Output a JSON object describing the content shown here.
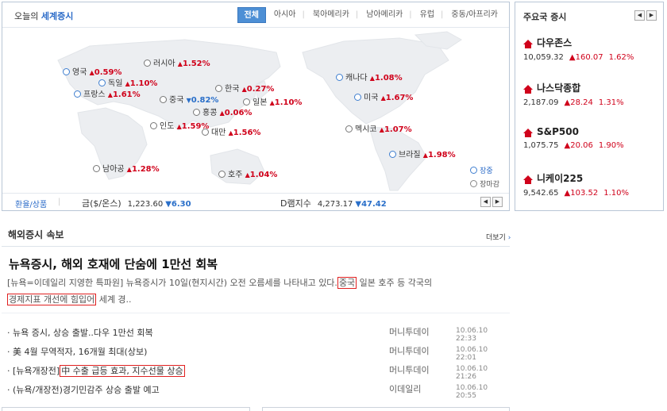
{
  "world": {
    "title_prefix": "오늘의 ",
    "title_main": "세계증시",
    "tabs": [
      "전체",
      "아시아",
      "북아메리카",
      "남아메리카",
      "유럽",
      "중동/아프리카"
    ],
    "markets": [
      {
        "name": "영국",
        "dir": "up",
        "value": "0.59%",
        "status": "day"
      },
      {
        "name": "독일",
        "dir": "up",
        "value": "1.10%",
        "status": "day"
      },
      {
        "name": "프랑스",
        "dir": "up",
        "value": "1.61%",
        "status": "day"
      },
      {
        "name": "러시아",
        "dir": "up",
        "value": "1.52%",
        "status": "closed"
      },
      {
        "name": "중국",
        "dir": "down",
        "value": "0.82%",
        "status": "closed"
      },
      {
        "name": "한국",
        "dir": "up",
        "value": "0.27%",
        "status": "closed"
      },
      {
        "name": "홍콩",
        "dir": "up",
        "value": "0.06%",
        "status": "closed"
      },
      {
        "name": "일본",
        "dir": "up",
        "value": "1.10%",
        "status": "closed"
      },
      {
        "name": "인도",
        "dir": "up",
        "value": "1.59%",
        "status": "closed"
      },
      {
        "name": "대만",
        "dir": "up",
        "value": "1.56%",
        "status": "closed"
      },
      {
        "name": "캐나다",
        "dir": "up",
        "value": "1.08%",
        "status": "day"
      },
      {
        "name": "미국",
        "dir": "up",
        "value": "1.67%",
        "status": "day"
      },
      {
        "name": "멕시코",
        "dir": "up",
        "value": "1.07%",
        "status": "closed"
      },
      {
        "name": "브라질",
        "dir": "up",
        "value": "1.98%",
        "status": "day"
      },
      {
        "name": "남아공",
        "dir": "up",
        "value": "1.28%",
        "status": "closed"
      },
      {
        "name": "호주",
        "dir": "up",
        "value": "1.04%",
        "status": "closed"
      }
    ],
    "legend": {
      "day": "장중",
      "closed": "장마감"
    },
    "footer": {
      "link": "환율/상품",
      "gold_label": "금($/온스)",
      "gold_value": "1,223.60",
      "gold_change": "▼6.30",
      "dram_label": "D램지수",
      "dram_value": "4,273.17",
      "dram_change": "▼47.42"
    },
    "colors": {
      "up": "#d0021b",
      "down": "#2a6fc9",
      "accent": "#4d8fd5"
    }
  },
  "major": {
    "title": "주요국 증시",
    "items": [
      {
        "name": "다우존스",
        "value": "10,059.32",
        "change": "▲160.07",
        "pct": "1.62%"
      },
      {
        "name": "나스닥종합",
        "value": "2,187.09",
        "change": "▲28.24",
        "pct": "1.31%"
      },
      {
        "name": "S&P500",
        "value": "1,075.75",
        "change": "▲20.06",
        "pct": "1.90%"
      },
      {
        "name": "니케이225",
        "value": "9,542.65",
        "change": "▲103.52",
        "pct": "1.10%"
      }
    ]
  },
  "news": {
    "title": "해외증시 속보",
    "more": "더보기",
    "headline": "뉴욕증시, 해외 호재에 단숨에 1만선 회복",
    "lead_1": "[뉴욕=이데일리 지영한 특파원] 뉴욕증시가 10일(현지시간) 오전 오름세를 나타내고 있다.",
    "lead_boxed_1": "중국",
    "lead_2": " 일본 호주 등 각국의",
    "lead_boxed_2": "경제지표 개선에 힘입어",
    "lead_3": " 세계 경..",
    "items": [
      {
        "title": "· 뉴욕 증시, 상승 출발..다우 1만선 회복",
        "source": "머니투데이",
        "time": "10.06.10 22:33"
      },
      {
        "title": "· 美 4월 무역적자, 16개월 최대(상보)",
        "source": "머니투데이",
        "time": "10.06.10 22:01"
      },
      {
        "title": "· [뉴욕개장전]",
        "title_boxed": "中 수출 급등 효과, 지수선물 상승",
        "source": "머니투데이",
        "time": "10.06.10 21:26"
      },
      {
        "title": "· (뉴욕/개장전)경기민감주 상승 출발 예고",
        "source": "이데일리",
        "time": "10.06.10 20:55"
      }
    ]
  }
}
